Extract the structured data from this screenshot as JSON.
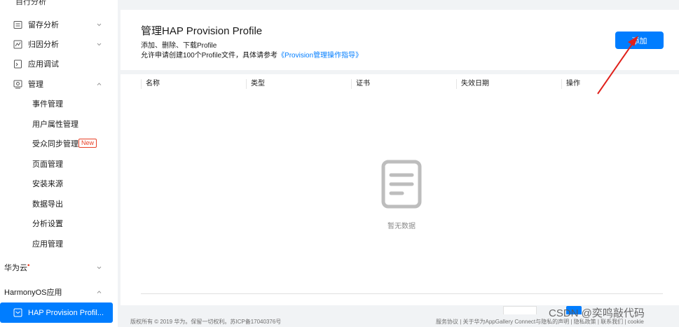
{
  "sidebar": {
    "clipped_top_label": "自行分析",
    "groups": [
      {
        "label": "留存分析",
        "icon": "list-icon"
      },
      {
        "label": "归因分析",
        "icon": "attribution-icon"
      },
      {
        "label": "应用调试",
        "icon": "debug-icon"
      },
      {
        "label": "管理",
        "icon": "manage-icon"
      }
    ],
    "manage_items": [
      {
        "label": "事件管理"
      },
      {
        "label": "用户属性管理"
      },
      {
        "label": "受众同步管理",
        "badge": "New"
      },
      {
        "label": "页面管理"
      },
      {
        "label": "安装来源"
      },
      {
        "label": "数据导出"
      },
      {
        "label": "分析设置"
      },
      {
        "label": "应用管理"
      }
    ],
    "huawei_cloud": "华为云",
    "huawei_cloud_dot": "•",
    "harmony_app": "HarmonyOS应用",
    "active_item": "HAP Provision Profil..."
  },
  "header": {
    "title": "管理HAP Provision Profile",
    "desc_line1": "添加、删除、下载Profile",
    "desc_line2_prefix": "允许申请创建100个Profile文件，具体请参考",
    "desc_line2_link": "《Provision管理操作指导》",
    "add_button": "添加"
  },
  "table": {
    "columns": [
      "名称",
      "类型",
      "证书",
      "失效日期",
      "操作"
    ],
    "rows": [],
    "empty_text": "暂无数据"
  },
  "footer": {
    "left": "版权所有 © 2019 华为。保留一切权利。苏ICP备17040376号",
    "right": "服务协议 | 关于华为AppGallery Connect与隐私的声明 | 隐私政策 | 联系我们 | cookie"
  },
  "watermark": "CSDN @奕鸣敲代码",
  "colors": {
    "accent": "#007dff",
    "badge": "#e84026",
    "annotation_arrow": "#e0201a"
  }
}
